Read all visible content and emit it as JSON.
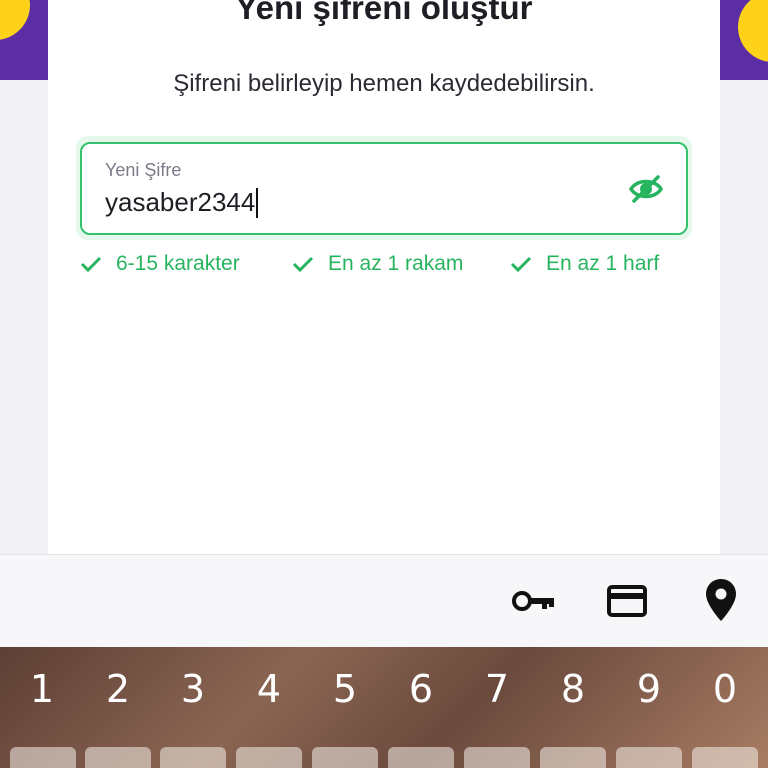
{
  "screen": {
    "title": "Yeni şifreni oluştur",
    "subtitle": "Şifreni belirleyip hemen kaydedebilirsin."
  },
  "password_field": {
    "label": "Yeni Şifre",
    "value": "yasaber2344",
    "toggle_icon": "eye-off-icon"
  },
  "rules": [
    {
      "text": "6-15 karakter",
      "status": "passed"
    },
    {
      "text": "En az 1 rakam",
      "status": "passed"
    },
    {
      "text": "En az 1 harf",
      "status": "passed"
    }
  ],
  "autofill_bar": {
    "icons": [
      "key-icon",
      "credit-card-icon",
      "location-pin-icon"
    ]
  },
  "keyboard": {
    "number_row": [
      "1",
      "2",
      "3",
      "4",
      "5",
      "6",
      "7",
      "8",
      "9",
      "0"
    ]
  },
  "colors": {
    "brand_purple": "#5b2ea6",
    "brand_yellow": "#ffd21a",
    "success_green": "#27b45f"
  }
}
